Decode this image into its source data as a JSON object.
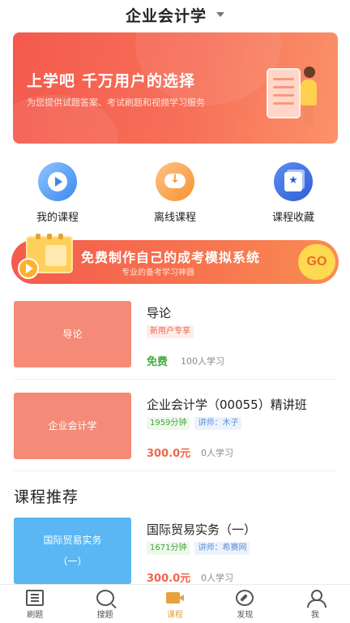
{
  "header": {
    "title": "企业会计学"
  },
  "banner": {
    "headline_brand": "上学吧",
    "headline_slogan": "千万用户的选择",
    "subtitle": "为您提供试题答案、考试刷题和视频学习服务"
  },
  "quick_actions": [
    {
      "label": "我的课程",
      "icon": "play-icon"
    },
    {
      "label": "离线课程",
      "icon": "cloud-download-icon"
    },
    {
      "label": "课程收藏",
      "icon": "star-collection-icon"
    }
  ],
  "promo": {
    "title": "免费制作自己的成考模拟系统",
    "subtitle": "专业的备考学习神器",
    "cta": "GO"
  },
  "courses": [
    {
      "thumb": "导论",
      "name": "导论",
      "tags": [
        "新用户专享"
      ],
      "price": "免费",
      "learners": "100人学习"
    },
    {
      "thumb": "企业会计学",
      "name": "企业会计学（00055）精讲班",
      "duration": "1959分钟",
      "teacher": "讲师：木子",
      "price": "300.0元",
      "learners": "0人学习"
    }
  ],
  "recommend": {
    "title": "课程推荐",
    "items": [
      {
        "thumb_line1": "国际贸易实务",
        "thumb_line2": "（一）",
        "name": "国际贸易实务（一）",
        "duration": "1671分钟",
        "teacher": "讲师：希赛网",
        "price": "300.0元",
        "learners": "0人学习"
      }
    ]
  },
  "tabbar": [
    {
      "label": "刷题",
      "icon": "list-icon",
      "active": false
    },
    {
      "label": "搜题",
      "icon": "search-icon",
      "active": false
    },
    {
      "label": "课程",
      "icon": "video-camera-icon",
      "active": true
    },
    {
      "label": "发现",
      "icon": "compass-icon",
      "active": false
    },
    {
      "label": "我",
      "icon": "user-icon",
      "active": false
    }
  ],
  "colors": {
    "accent": "#e8a03e",
    "banner": "#f45a4d",
    "price": "#f0654c",
    "free": "#3fae3c"
  }
}
